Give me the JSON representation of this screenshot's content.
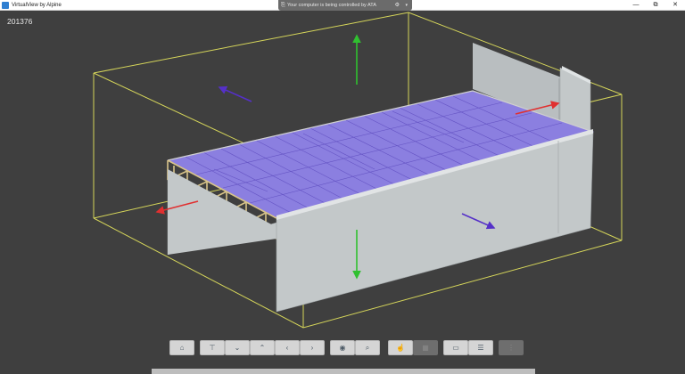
{
  "window": {
    "title": "VirtualView by Alpine",
    "minimize_glyph": "—",
    "maximize_glyph": "⧉",
    "close_glyph": "✕"
  },
  "remote_banner": {
    "text": "Your computer is being controlled by ATA",
    "icon": "remote-control-icon",
    "gear_icon": "gear-icon",
    "chevron_icon": "chevron-down-icon"
  },
  "viewport": {
    "job_number": "201376",
    "colors": {
      "background": "#3f3f3f",
      "bounding_box": "#d6d65a",
      "roof_fill": "#8b7fe0",
      "wall_fill": "#c3c8c9",
      "truss_wood": "#d8c48a",
      "arrow_x": "#e03030",
      "arrow_y": "#30c030",
      "arrow_z": "#5530c8"
    }
  },
  "toolbar": {
    "buttons": [
      {
        "name": "home-button",
        "icon": "home-icon",
        "glyph": "⌂",
        "enabled": true
      },
      {
        "name": "top-view-button",
        "icon": "top-view-icon",
        "glyph": "⊤",
        "enabled": true
      },
      {
        "name": "down-button",
        "icon": "chevron-down-icon",
        "glyph": "⌄",
        "enabled": true
      },
      {
        "name": "up-button",
        "icon": "chevron-up-icon",
        "glyph": "⌃",
        "enabled": true
      },
      {
        "name": "left-button",
        "icon": "chevron-left-icon",
        "glyph": "‹",
        "enabled": true
      },
      {
        "name": "right-button",
        "icon": "chevron-right-icon",
        "glyph": "›",
        "enabled": true
      },
      {
        "name": "view-button",
        "icon": "eye-icon",
        "glyph": "◉",
        "enabled": true
      },
      {
        "name": "zoom-button",
        "icon": "zoom-icon",
        "glyph": "⌕",
        "enabled": true
      },
      {
        "name": "select-button",
        "icon": "hand-pointer-icon",
        "glyph": "☝",
        "enabled": true
      },
      {
        "name": "disabled-tool-button",
        "icon": "tool-icon",
        "glyph": "▦",
        "enabled": false
      },
      {
        "name": "measure-button",
        "icon": "ruler-icon",
        "glyph": "▭",
        "enabled": true
      },
      {
        "name": "layers-button",
        "icon": "layers-icon",
        "glyph": "☰",
        "enabled": true
      },
      {
        "name": "more-button",
        "icon": "more-icon",
        "glyph": "⋮",
        "enabled": false
      }
    ]
  }
}
